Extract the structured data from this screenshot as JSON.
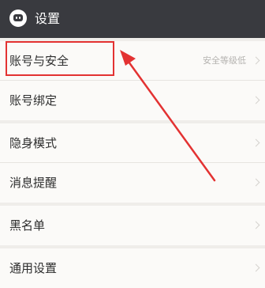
{
  "header": {
    "title": "设置",
    "app_icon": "chat-bubble-icon"
  },
  "rows": [
    {
      "label": "账号与安全",
      "sub": "安全等级低"
    },
    {
      "label": "账号绑定"
    },
    {
      "label": "隐身模式"
    },
    {
      "label": "消息提醒"
    },
    {
      "label": "黑名单"
    },
    {
      "label": "通用设置"
    }
  ],
  "colors": {
    "header_bg": "#393a3f",
    "page_bg": "#efedea",
    "row_bg": "#fbfaf8",
    "annotation": "#e33232"
  },
  "icons": {
    "row_arrow": "chevron-right-icon"
  }
}
